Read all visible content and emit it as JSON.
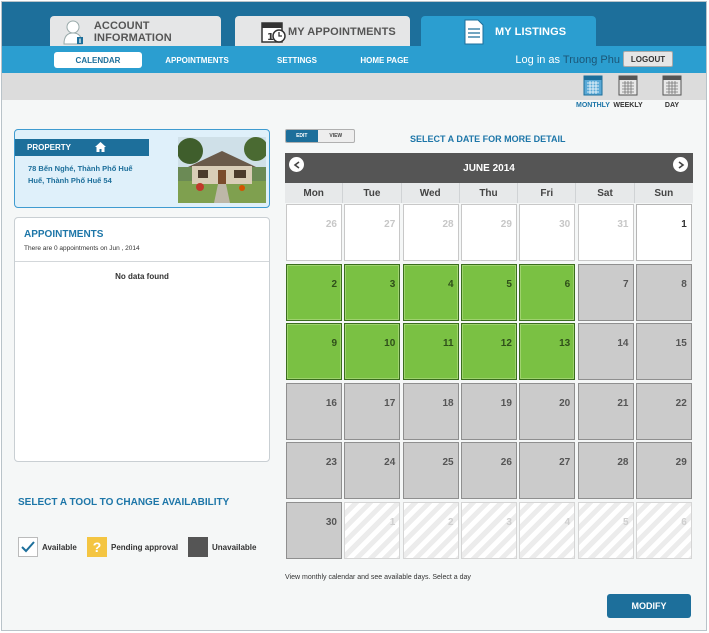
{
  "colors": {
    "header_bg": "#1d6f9b",
    "accent": "#2b9ed0",
    "available": "#7ac143",
    "unavailable": "#cbcbcb",
    "pending": "#f4c542",
    "title_blue": "#1d76a8"
  },
  "tabs": [
    {
      "label": "ACCOUNT INFORMATION",
      "icon": "user-info-icon",
      "active": false
    },
    {
      "label": "MY APPOINTMENTS",
      "icon": "calendar-clock-icon",
      "active": false
    },
    {
      "label": "MY LISTINGS",
      "icon": "document-icon",
      "active": true
    }
  ],
  "subnav": {
    "items": [
      "CALENDAR",
      "APPOINTMENTS",
      "SETTINGS",
      "HOME PAGE"
    ],
    "selected": "CALENDAR"
  },
  "login": {
    "prefix": "Log in as",
    "username": "Truong Phu",
    "logout_label": "LOGOUT"
  },
  "views": [
    {
      "label": "MONTHLY",
      "icon": "calendar-month-icon",
      "selected": true
    },
    {
      "label": "WEEKLY",
      "icon": "calendar-week-icon",
      "selected": false
    },
    {
      "label": "DAY",
      "icon": "calendar-day-icon",
      "selected": false
    }
  ],
  "property": {
    "title": "PROPERTY",
    "address_line1": "78 Bến Nghé, Thành Phố Huế",
    "address_line2": "Huế, Thành Phố Huế 54"
  },
  "appointments": {
    "title": "APPOINTMENTS",
    "subtitle": "There are 0 appointments on Jun , 2014",
    "empty": "No data found"
  },
  "tools": {
    "title": "SELECT A TOOL TO CHANGE AVAILABILITY",
    "available": "Available",
    "pending": "Pending approval",
    "unavailable": "Unavailable"
  },
  "calendar": {
    "mode_edit": "EDIT",
    "mode_view": "VIEW",
    "select_hint": "SELECT A DATE FOR MORE DETAIL",
    "month_title": "JUNE 2014",
    "days": [
      "Mon",
      "Tue",
      "Wed",
      "Thu",
      "Fri",
      "Sat",
      "Sun"
    ],
    "weeks": [
      [
        {
          "d": "26",
          "s": "out"
        },
        {
          "d": "27",
          "s": "out"
        },
        {
          "d": "28",
          "s": "out"
        },
        {
          "d": "29",
          "s": "out"
        },
        {
          "d": "30",
          "s": "out"
        },
        {
          "d": "31",
          "s": "out"
        },
        {
          "d": "1",
          "s": "plain"
        }
      ],
      [
        {
          "d": "2",
          "s": "avail"
        },
        {
          "d": "3",
          "s": "avail"
        },
        {
          "d": "4",
          "s": "avail"
        },
        {
          "d": "5",
          "s": "avail"
        },
        {
          "d": "6",
          "s": "avail"
        },
        {
          "d": "7",
          "s": "unavail"
        },
        {
          "d": "8",
          "s": "unavail"
        }
      ],
      [
        {
          "d": "9",
          "s": "avail"
        },
        {
          "d": "10",
          "s": "avail"
        },
        {
          "d": "11",
          "s": "avail"
        },
        {
          "d": "12",
          "s": "avail"
        },
        {
          "d": "13",
          "s": "avail"
        },
        {
          "d": "14",
          "s": "unavail"
        },
        {
          "d": "15",
          "s": "unavail"
        }
      ],
      [
        {
          "d": "16",
          "s": "unavail"
        },
        {
          "d": "17",
          "s": "unavail"
        },
        {
          "d": "18",
          "s": "unavail"
        },
        {
          "d": "19",
          "s": "unavail"
        },
        {
          "d": "20",
          "s": "unavail"
        },
        {
          "d": "21",
          "s": "unavail"
        },
        {
          "d": "22",
          "s": "unavail"
        }
      ],
      [
        {
          "d": "23",
          "s": "unavail"
        },
        {
          "d": "24",
          "s": "unavail"
        },
        {
          "d": "25",
          "s": "unavail"
        },
        {
          "d": "26",
          "s": "unavail"
        },
        {
          "d": "27",
          "s": "unavail"
        },
        {
          "d": "28",
          "s": "unavail"
        },
        {
          "d": "29",
          "s": "unavail"
        }
      ],
      [
        {
          "d": "30",
          "s": "unavail"
        },
        {
          "d": "1",
          "s": "out-hatch"
        },
        {
          "d": "2",
          "s": "out-hatch"
        },
        {
          "d": "3",
          "s": "out-hatch"
        },
        {
          "d": "4",
          "s": "out-hatch"
        },
        {
          "d": "5",
          "s": "out-hatch"
        },
        {
          "d": "6",
          "s": "out-hatch"
        }
      ]
    ],
    "footnote": "View monthly calendar and see available days.  Select a day",
    "modify_label": "MODIFY"
  }
}
